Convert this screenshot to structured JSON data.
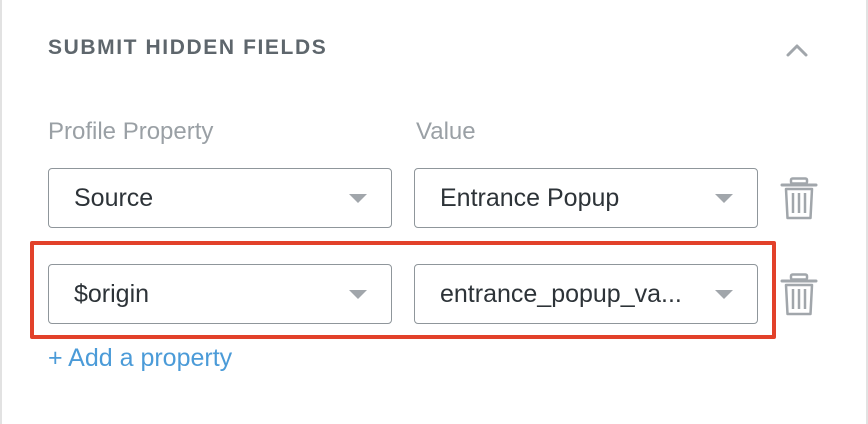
{
  "section": {
    "title": "SUBMIT HIDDEN FIELDS",
    "collapse_icon": "chevron-up-icon"
  },
  "columns": {
    "property_label": "Profile Property",
    "value_label": "Value"
  },
  "rows": [
    {
      "property": "Source",
      "value": "Entrance Popup",
      "delete_icon": "trash-icon"
    },
    {
      "property": "$origin",
      "value": "entrance_popup_va...",
      "delete_icon": "trash-icon",
      "highlighted": true
    }
  ],
  "add_property": {
    "label": "+ Add a property"
  },
  "colors": {
    "highlight": "#e2412a",
    "link": "#4b9bd8",
    "title": "#5e666c",
    "label": "#9aa0a5"
  }
}
